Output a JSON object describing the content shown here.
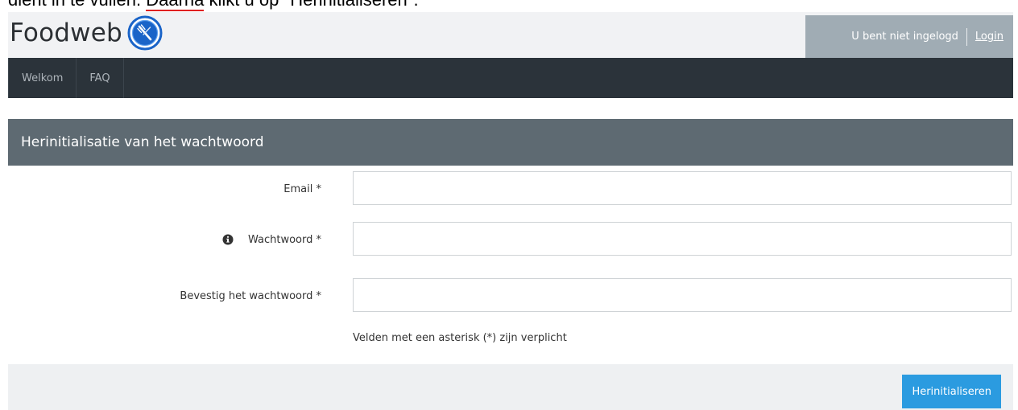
{
  "top_clip": {
    "text_before": "dient in te vullen. ",
    "underlined": "Daarna",
    "text_after": " klikt u op \"Herinitialiseren\"."
  },
  "header": {
    "brand": "Foodweb",
    "logo_icon": "fork-knife-icon",
    "user_status": "U bent niet ingelogd",
    "login_link": "Login"
  },
  "nav": {
    "items": [
      {
        "label": "Welkom"
      },
      {
        "label": "FAQ"
      }
    ]
  },
  "panel": {
    "title": "Herinitialisatie van het wachtwoord"
  },
  "form": {
    "fields": [
      {
        "label": "Email *",
        "value": "",
        "placeholder": ""
      },
      {
        "label": "Wachtwoord *",
        "value": "",
        "placeholder": "",
        "icon": "info-icon"
      },
      {
        "label": "Bevestig het wachtwoord *",
        "value": "",
        "placeholder": ""
      }
    ],
    "required_note": "Velden met een asterisk (*) zijn verplicht",
    "submit_label": "Herinitialiseren"
  },
  "colors": {
    "header_bg": "#f1f2f4",
    "user_box_bg": "#a0acb4",
    "nav_bg": "#2b333a",
    "panel_title_bg": "#5e6a72",
    "button_bg": "#2b9be0",
    "logo_blue": "#1a64c8"
  }
}
